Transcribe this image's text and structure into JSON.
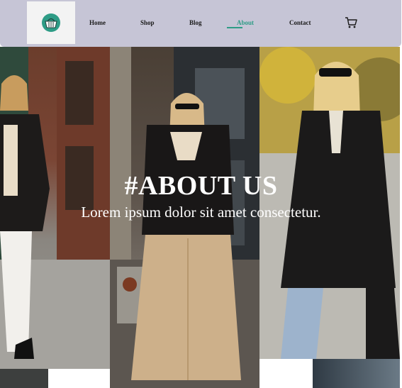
{
  "nav": {
    "logo": "basket-logo-icon",
    "links": [
      {
        "label": "Home",
        "active": false
      },
      {
        "label": "Shop",
        "active": false
      },
      {
        "label": "Blog",
        "active": false
      },
      {
        "label": "About",
        "active": true
      },
      {
        "label": "Contact",
        "active": false
      }
    ],
    "cart": "cart-icon"
  },
  "hero": {
    "title": "#ABOUT US",
    "subtitle": "Lorem ipsum dolor sit amet consectetur."
  },
  "colors": {
    "nav_bg": "#c6c5d6",
    "accent": "#2e9c86",
    "text_dark": "#1a1a1a"
  }
}
